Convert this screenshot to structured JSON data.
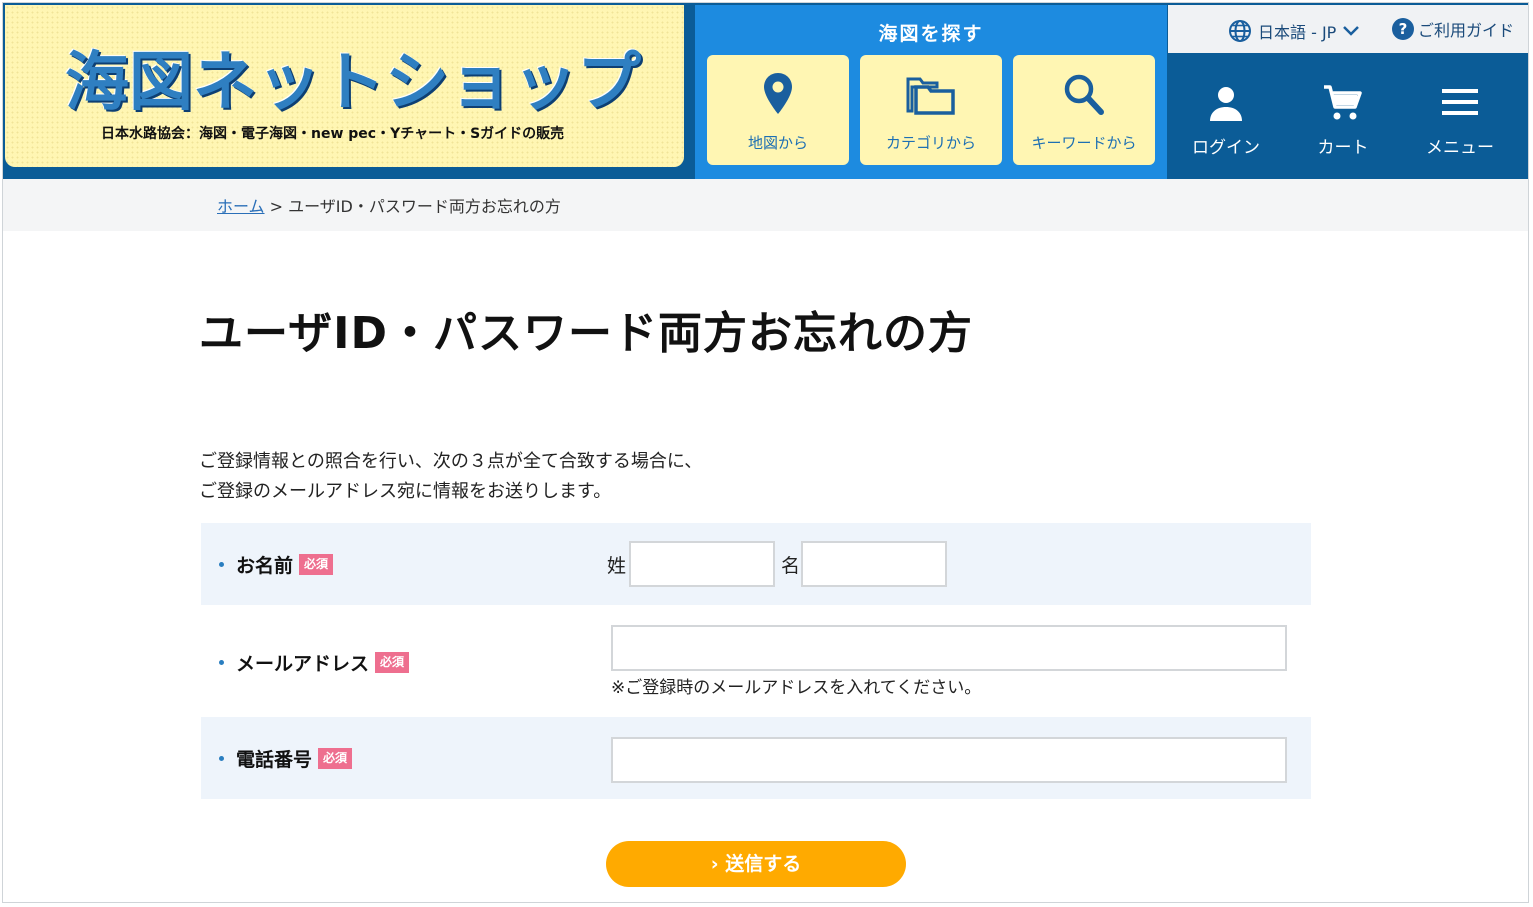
{
  "header": {
    "logo_title": "海図ネットショップ",
    "logo_subtitle": "日本水路協会：海図・電子海図・new pec・Yチャート・Sガイドの販売",
    "search_title": "海図を探す",
    "search_buttons": [
      {
        "label": "地図から",
        "icon": "map-pin-icon"
      },
      {
        "label": "カテゴリから",
        "icon": "folders-icon"
      },
      {
        "label": "キーワードから",
        "icon": "search-icon"
      }
    ],
    "language": "日本語 - JP",
    "guide": "ご利用ガイド",
    "guide_icon_glyph": "?",
    "nav": [
      {
        "label": "ログイン",
        "icon": "user-icon"
      },
      {
        "label": "カート",
        "icon": "cart-icon"
      },
      {
        "label": "メニュー",
        "icon": "hamburger-icon"
      }
    ]
  },
  "breadcrumb": {
    "home": "ホーム",
    "separator": " > ",
    "current": "ユーザID・パスワード両方お忘れの方"
  },
  "page": {
    "title": "ユーザID・パスワード両方お忘れの方",
    "intro_line1": "ご登録情報との照合を行い、次の３点が全て合致する場合に、",
    "intro_line2": "ご登録のメールアドレス宛に情報をお送りします。"
  },
  "form": {
    "required_badge": "必須",
    "name_label": "お名前",
    "last_name_label": "姓",
    "first_name_label": "名",
    "last_name_value": "",
    "first_name_value": "",
    "email_label": "メールアドレス",
    "email_value": "",
    "email_note": "※ご登録時のメールアドレスを入れてください。",
    "phone_label": "電話番号",
    "phone_value": "",
    "submit_label": "› 送信する"
  },
  "colors": {
    "header_navy": "#0b5c97",
    "search_blue": "#1d8be0",
    "logo_yellow": "#fff6b3",
    "required_pink": "#ee6f8f",
    "submit_orange": "#ffaa00",
    "row_tint": "#eef4fb"
  }
}
